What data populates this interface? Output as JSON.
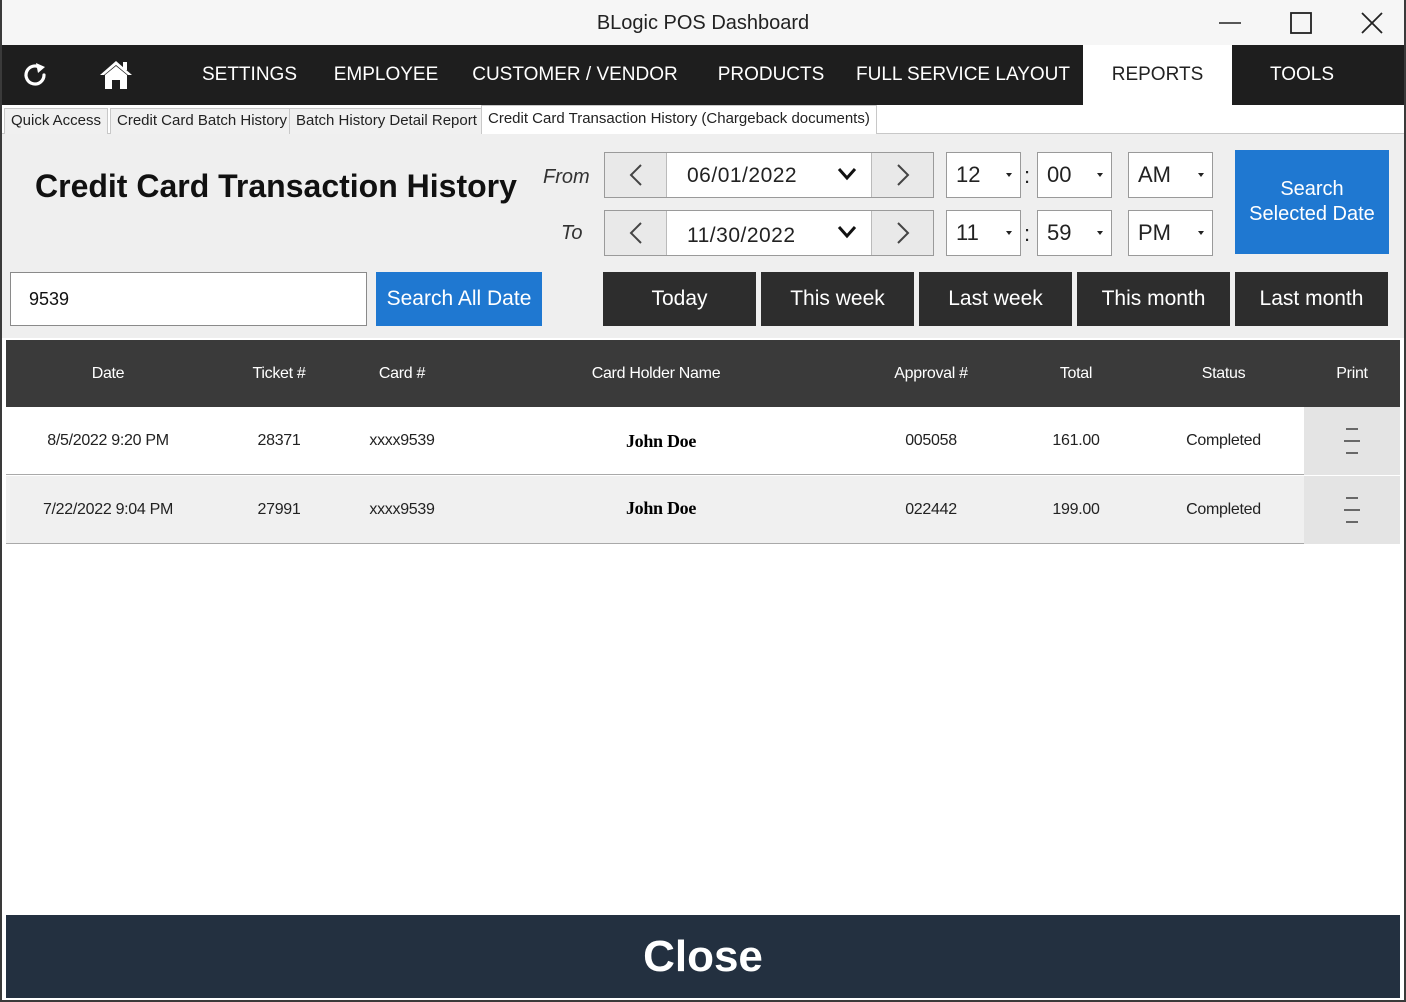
{
  "window": {
    "title": "BLogic POS Dashboard"
  },
  "nav": {
    "refresh_icon": "refresh-icon",
    "home_icon": "home-icon",
    "items": [
      "SETTINGS",
      "EMPLOYEE",
      "CUSTOMER / VENDOR",
      "PRODUCTS",
      "FULL SERVICE LAYOUT",
      "REPORTS",
      "TOOLS"
    ],
    "active": "REPORTS"
  },
  "subtabs": [
    "Quick Access",
    "Credit Card Batch History",
    "Batch History Detail Report",
    "Credit Card Transaction History (Chargeback documents)"
  ],
  "filter": {
    "page_title": "Credit Card Transaction History",
    "from_label": "From",
    "to_label": "To",
    "from_date": "06/01/2022",
    "to_date": "11/30/2022",
    "from_hour": "12",
    "from_minute": "00",
    "from_ampm": "AM",
    "to_hour": "11",
    "to_minute": "59",
    "to_ampm": "PM",
    "colon": ":",
    "search_selected_line1": "Search",
    "search_selected_line2": "Selected Date",
    "search_value": "9539",
    "search_all_label": "Search All Date",
    "quick_ranges": [
      "Today",
      "This week",
      "Last week",
      "This month",
      "Last month"
    ]
  },
  "table": {
    "headers": [
      "Date",
      "Ticket #",
      "Card #",
      "Card Holder Name",
      "Approval #",
      "Total",
      "Status",
      "Print"
    ],
    "rows": [
      {
        "date": "8/5/2022 9:20 PM",
        "ticket": "28371",
        "card": "xxxx9539",
        "name": "John Doe",
        "approval": "005058",
        "total": "161.00",
        "status": "Completed"
      },
      {
        "date": "7/22/2022 9:04 PM",
        "ticket": "27991",
        "card": "xxxx9539",
        "name": "John Doe",
        "approval": "022442",
        "total": "199.00",
        "status": "Completed"
      }
    ]
  },
  "footer": {
    "close_label": "Close"
  }
}
